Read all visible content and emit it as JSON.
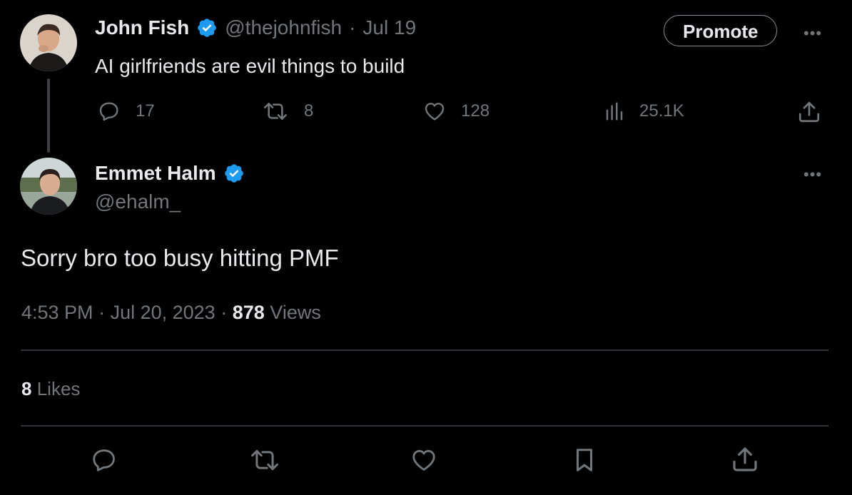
{
  "parent_tweet": {
    "name": "John Fish",
    "handle": "@thejohnfish",
    "date": "Jul 19",
    "text": "AI girlfriends are evil things to build",
    "promote_label": "Promote",
    "more_label": "•••",
    "replies": "17",
    "retweets": "8",
    "likes": "128",
    "views": "25.1K"
  },
  "reply_tweet": {
    "name": "Emmet Halm",
    "handle": "@ehalm_",
    "more_label": "•••",
    "text": "Sorry bro too busy hitting PMF",
    "time": "4:53 PM",
    "date": "Jul 20, 2023",
    "views_count": "878",
    "views_label": "Views",
    "likes_count": "8",
    "likes_label": "Likes"
  },
  "colors": {
    "background": "#000000",
    "text": "#e7e9ea",
    "muted": "#71767b",
    "verified": "#1d9bf0",
    "divider": "#2f3336"
  }
}
